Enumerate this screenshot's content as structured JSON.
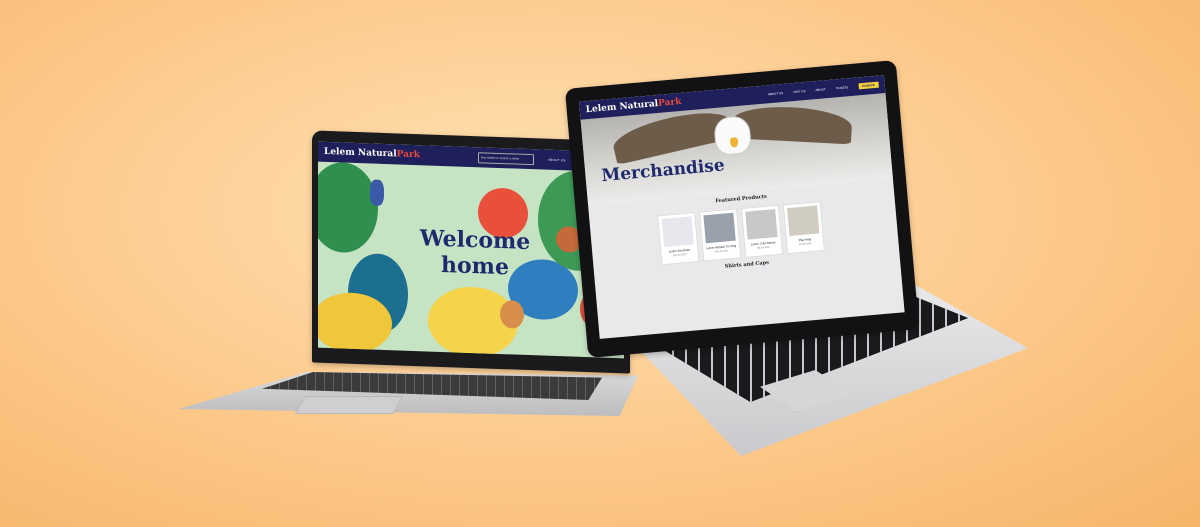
{
  "left_site": {
    "brand_name": "Lelem Natural",
    "brand_accent": "Park",
    "search_placeholder": "Buy tickets or search a ticket",
    "nav_items": [
      "ABOUT US",
      "VISIT US",
      "SHOP"
    ],
    "hero_text_line1": "Welcome",
    "hero_text_line2": "home",
    "colors": {
      "nav": "#1f1f5c",
      "accent": "#e84a3c",
      "hero_text": "#1f2a6e"
    }
  },
  "right_site": {
    "brand_name": "Lelem Natural",
    "brand_accent": "Park",
    "nav_items": [
      "ABOUT US",
      "VISIT US",
      "ABOUT",
      "TICKETS"
    ],
    "donate_label": "DONATE",
    "hero_title": "Merchandise",
    "featured_title": "Featured Products",
    "products": [
      {
        "name": "Lelem Keychain",
        "price": "$10.00 USD"
      },
      {
        "name": "Lelem Natural Tin Mug",
        "price": "$15.00 USD"
      },
      {
        "name": "Lelem Cold Stamp",
        "price": "$5.00 USD"
      },
      {
        "name": "Play Mug",
        "price": "$7.00 USD"
      }
    ],
    "shirts_title": "Shirts and Caps",
    "colors": {
      "nav": "#1f1f5c",
      "donate": "#f3d23b"
    }
  }
}
